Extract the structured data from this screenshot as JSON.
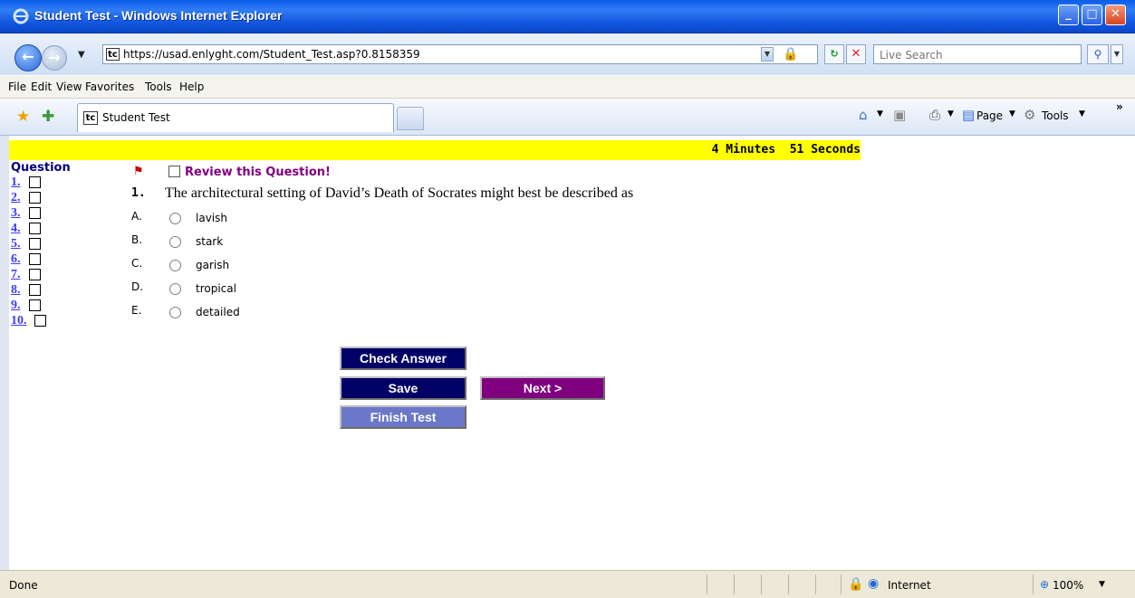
{
  "window": {
    "title": "Student Test - Windows Internet Explorer"
  },
  "address_bar": {
    "url": "https://usad.enlyght.com/Student_Test.asp?0.8158359",
    "search_placeholder": "Live Search"
  },
  "menu": [
    "File",
    "Edit",
    "View",
    "Favorites",
    "Tools",
    "Help"
  ],
  "tab": {
    "label": "Student Test"
  },
  "commands": {
    "page": "Page",
    "tools": "Tools"
  },
  "timer": {
    "text": "4 Minutes  51 Seconds"
  },
  "question_nav": {
    "title": "Question",
    "items": [
      "1.",
      "2.",
      "3.",
      "4.",
      "5.",
      "6.",
      "7.",
      "8.",
      "9.",
      "10."
    ]
  },
  "review": {
    "label": "Review this Question!"
  },
  "question": {
    "number": "1.",
    "text": "The architectural setting of David’s Death of Socrates might best be described as",
    "options": [
      {
        "letter": "A.",
        "text": "lavish"
      },
      {
        "letter": "B.",
        "text": "stark"
      },
      {
        "letter": "C.",
        "text": "garish"
      },
      {
        "letter": "D.",
        "text": "tropical"
      },
      {
        "letter": "E.",
        "text": "detailed"
      }
    ]
  },
  "buttons": {
    "check_answer": "Check Answer",
    "save": "Save",
    "next": "Next >",
    "finish": "Finish Test"
  },
  "status": {
    "text": "Done",
    "zone": "Internet",
    "zoom": "100%"
  }
}
